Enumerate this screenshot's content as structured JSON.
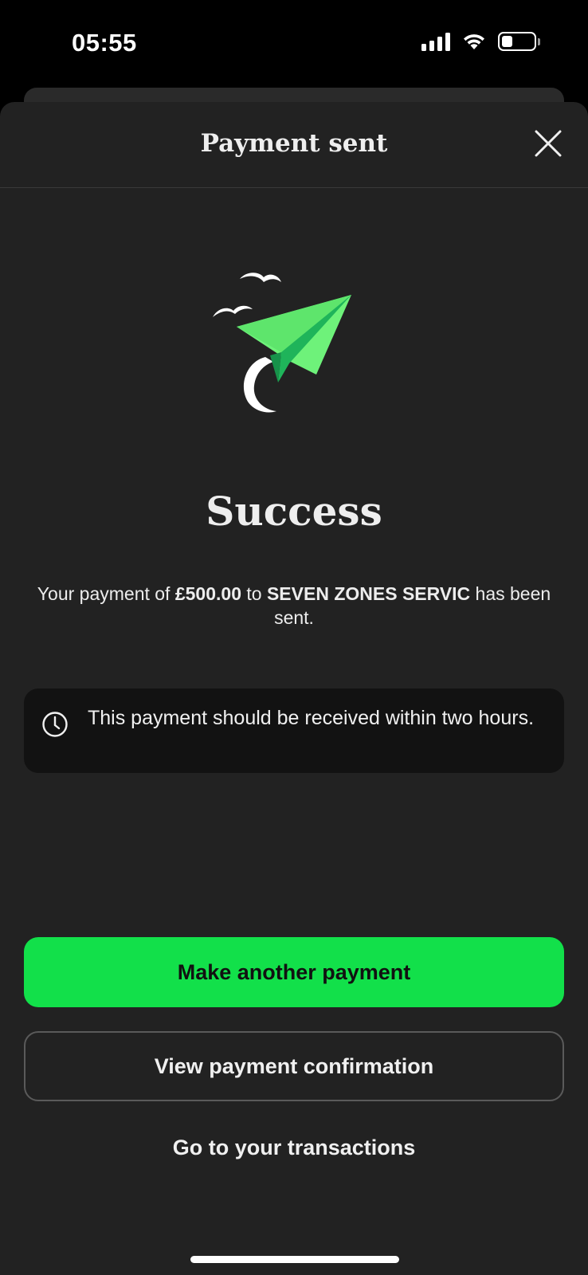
{
  "status_bar": {
    "time": "05:55",
    "battery_level": 0.35
  },
  "sheet": {
    "title": "Payment sent",
    "close_icon": "close-icon"
  },
  "illustration": {
    "icon": "paper-plane-icon",
    "colors": {
      "plane_light": "#6ef27a",
      "plane_dark": "#1fb45a",
      "birds": "#ffffff"
    }
  },
  "result": {
    "title": "Success",
    "message_prefix": "Your payment of ",
    "amount": "£500.00",
    "message_middle": " to ",
    "payee": "SEVEN ZONES SERVIC",
    "message_suffix": " has been sent."
  },
  "info": {
    "icon": "clock-icon",
    "text": "This payment should be received within two hours."
  },
  "actions": {
    "primary_label": "Make another payment",
    "secondary_label": "View payment confirmation",
    "link_label": "Go to your transactions"
  },
  "colors": {
    "accent": "#12e04a",
    "background": "#222222",
    "info_box": "#121212"
  }
}
